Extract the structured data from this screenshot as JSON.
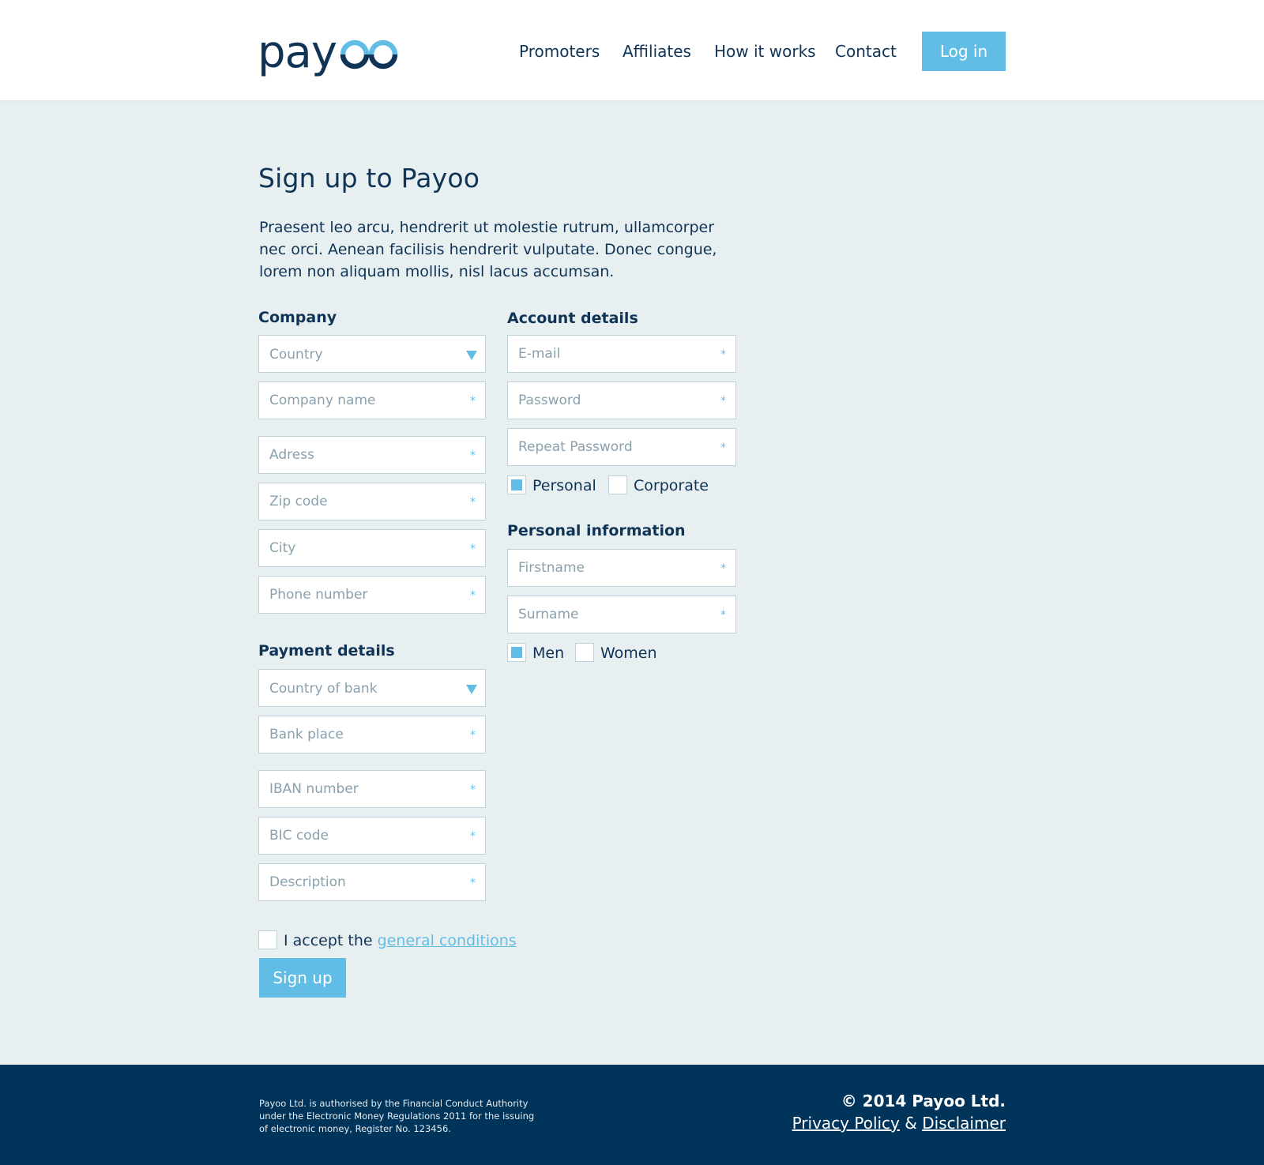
{
  "brand": {
    "name": "payoo",
    "dark": "#0f3456",
    "accent": "#62bde6"
  },
  "nav": {
    "items": [
      {
        "label": "Promoters"
      },
      {
        "label": "Affiliates"
      },
      {
        "label": "How it works"
      },
      {
        "label": "Contact"
      }
    ],
    "login_label": "Log in"
  },
  "intro": {
    "title": "Sign up to Payoo",
    "text": "Praesent leo arcu, hendrerit ut molestie rutrum, ullamcorper nec orci. Aenean facilisis hendrerit vulputate. Donec congue, lorem non aliquam mollis, nisl lacus accumsan."
  },
  "company": {
    "title": "Company",
    "country": "Country",
    "company_name": "Company name",
    "address": "Adress",
    "zip": "Zip code",
    "city": "City",
    "phone": "Phone number"
  },
  "payment": {
    "title": "Payment details",
    "country_of_bank": "Country of bank",
    "bank_place": "Bank place",
    "iban": "IBAN number",
    "bic": "BIC code",
    "description": "Description"
  },
  "account": {
    "title": "Account details",
    "email": "E-mail",
    "password": "Password",
    "repeat_password": "Repeat Password",
    "type_personal": "Personal",
    "type_corporate": "Corporate",
    "personal_checked": true,
    "corporate_checked": false
  },
  "personal": {
    "title": "Personal information",
    "firstname": "Firstname",
    "surname": "Surname",
    "men": "Men",
    "women": "Women",
    "men_checked": true,
    "women_checked": false
  },
  "required_marker": "*",
  "terms": {
    "prefix": "I accept the",
    "link": "general conditions",
    "checked": false
  },
  "signup_label": "Sign up",
  "footer": {
    "legal": "Payoo Ltd. is authorised by the Financial Conduct Authority under the Electronic Money Regulations 2011 for the issuing of electronic money, Register No. 123456.",
    "copyright": "© 2014 Payoo Ltd.",
    "privacy": "Privacy Policy",
    "amp": "&",
    "disclaimer": "Disclaimer"
  }
}
